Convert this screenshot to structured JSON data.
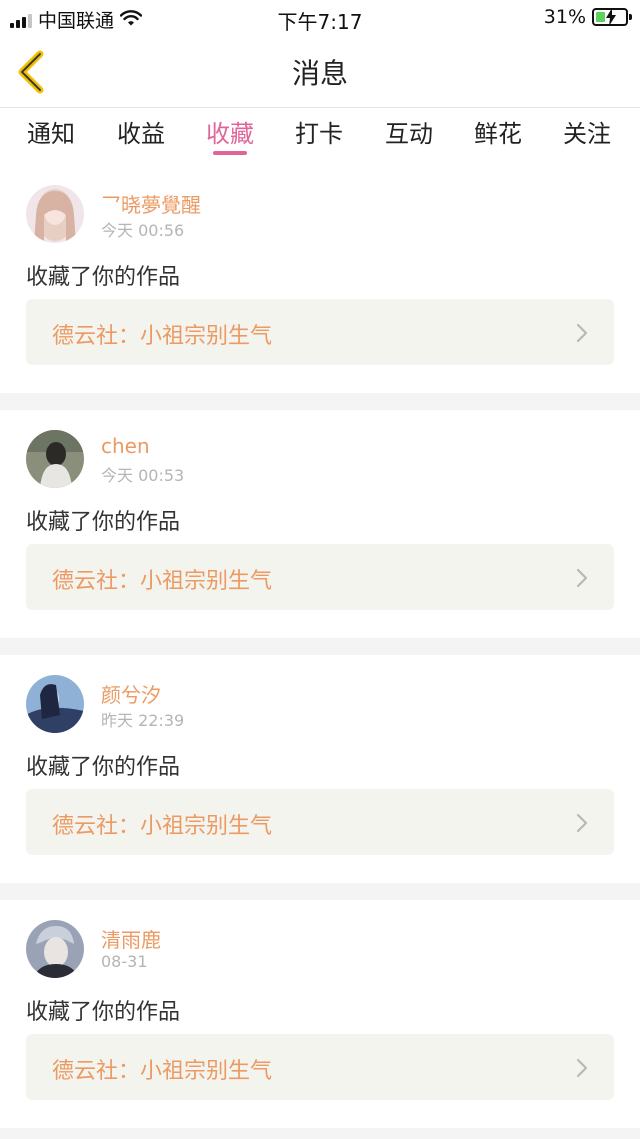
{
  "status_bar": {
    "carrier": "中国联通",
    "time": "下午7:17",
    "battery": "31%",
    "battery_level": 0.31,
    "icons": [
      "signal-icon",
      "wifi-icon",
      "battery-icon"
    ]
  },
  "nav": {
    "title": "消息",
    "back_icon": "chevron-left-icon"
  },
  "tabs": [
    {
      "label": "通知"
    },
    {
      "label": "收益"
    },
    {
      "label": "收藏"
    },
    {
      "label": "打卡"
    },
    {
      "label": "互动"
    },
    {
      "label": "鲜花"
    },
    {
      "label": "关注"
    }
  ],
  "active_tab": "收藏",
  "messages": [
    {
      "user": "乛晓夢覺醒",
      "time": "今天 00:56",
      "action": "收藏了你的作品",
      "work": "德云社：小祖宗别生气"
    },
    {
      "user": "chen",
      "time": "今天 00:53",
      "action": "收藏了你的作品",
      "work": "德云社：小祖宗别生气"
    },
    {
      "user": "颜兮汐",
      "time": "昨天 22:39",
      "action": "收藏了你的作品",
      "work": "德云社：小祖宗别生气"
    },
    {
      "user": "清雨鹿",
      "time": "08-31",
      "action": "收藏了你的作品",
      "work": "德云社：小祖宗别生气"
    }
  ],
  "colors": {
    "accent_pink": "#e0669a",
    "username_orange": "#ec9a63",
    "back_arrow_yellow": "#f2c200",
    "link_bg": "#f4f4ef",
    "divider_gray": "#f4f4f4",
    "battery_green": "#5bd35a"
  }
}
